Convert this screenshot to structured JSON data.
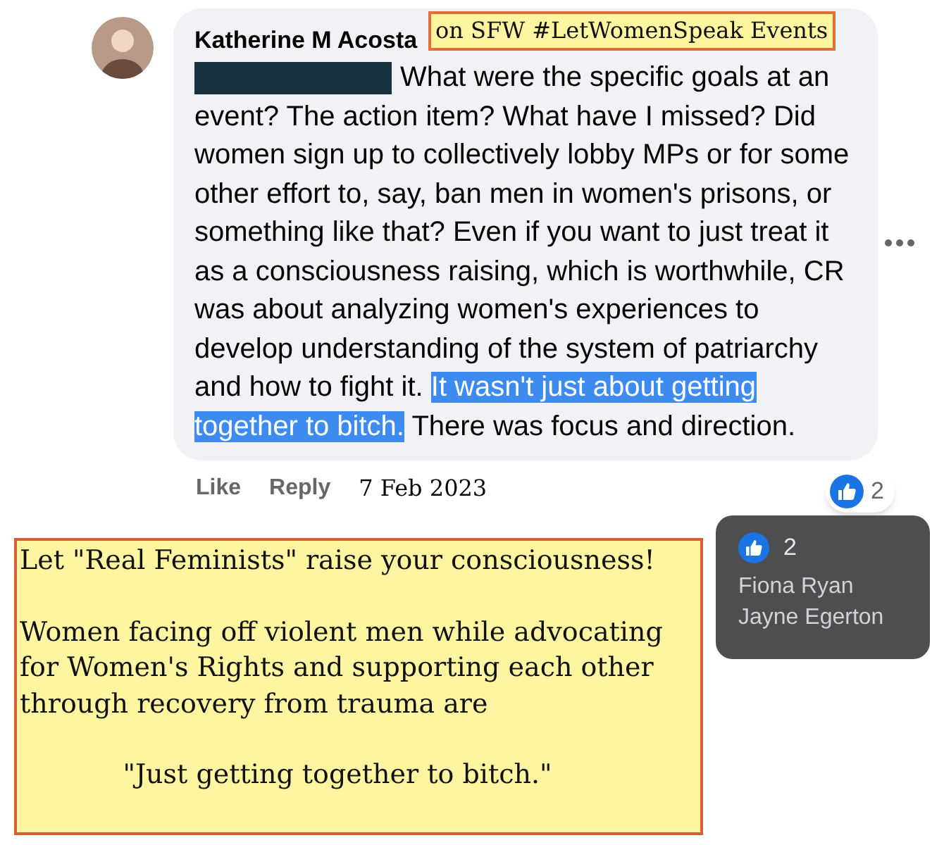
{
  "comment": {
    "author": "Katherine M Acosta",
    "redacted": true,
    "segments": [
      {
        "text": "What were the specific goals at an event? The action item? What have I missed? Did women sign up to collectively lobby MPs or for some other effort to, say, ban men in women's prisons, or something like that? Even if you want to just treat it as a consciousness raising, which is worthwhile, CR was about analyzing women's experiences to develop understanding of the system of patriarchy and how to fight it.",
        "selected": false
      },
      {
        "text": "It wasn't just about getting together to bitch.",
        "selected": true
      },
      {
        "text": "There was focus and direction.",
        "selected": false
      }
    ],
    "actions": [
      "Like",
      "Reply"
    ],
    "date": "7 Feb 2023",
    "reaction_count": "2"
  },
  "label": "on SFW #LetWomenSpeak Events",
  "note": [
    {
      "kind": "heading",
      "text": "Let \"Real Feminists\" raise your consciousness!"
    },
    {
      "kind": "body",
      "text": "Women facing off violent men while advocating for Women's Rights and supporting each other through recovery from trauma are"
    },
    {
      "kind": "quote",
      "text": "\"Just getting together to bitch.\""
    }
  ],
  "tooltip": {
    "count": "2",
    "names": [
      "Fiona Ryan",
      "Jayne Egerton"
    ]
  }
}
